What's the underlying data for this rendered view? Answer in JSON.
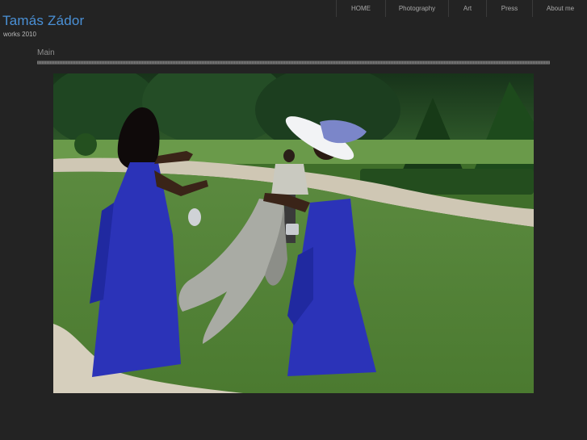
{
  "site": {
    "title": "Tamás Zádor",
    "subtitle": "works 2010"
  },
  "nav": {
    "items": [
      {
        "label": "HOME"
      },
      {
        "label": "Photography"
      },
      {
        "label": "Art"
      },
      {
        "label": "Press"
      },
      {
        "label": "About me"
      }
    ]
  },
  "main": {
    "section_title": "Main",
    "photo": {
      "subject": "two women in royal blue gowns dancing on a lawn, one in a white wide-brimmed hat, a grey coat flying between them"
    }
  },
  "colors": {
    "background": "#232323",
    "title_blue": "#4a90d6",
    "nav_text": "#a9a9a9",
    "dress_blue": "#2b33b8",
    "lawn_green": "#4f7f36"
  }
}
